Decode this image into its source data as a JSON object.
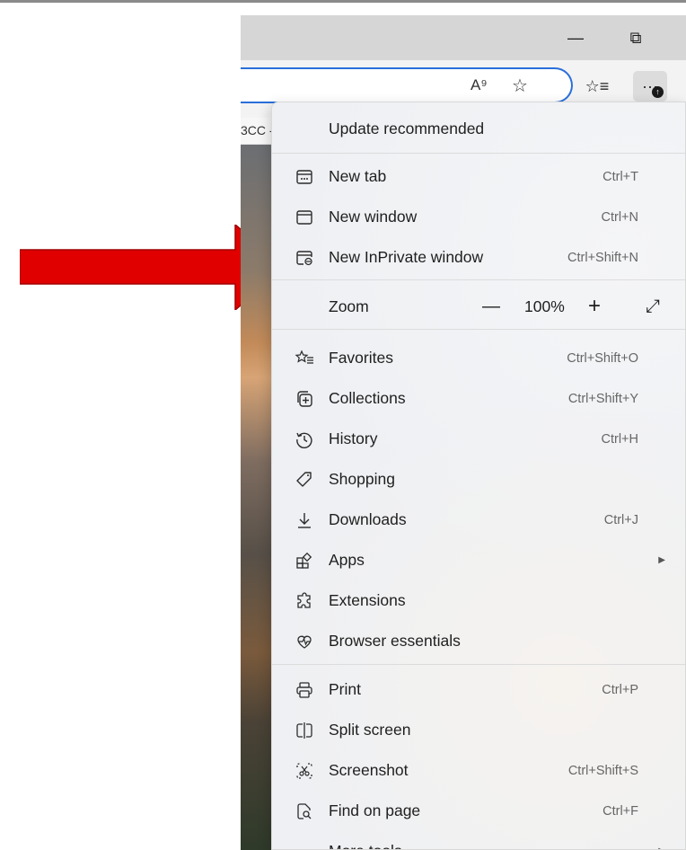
{
  "window": {
    "minimize_glyph": "—",
    "restore_glyph": "⧉"
  },
  "toolbar": {
    "read_aloud_icon": "A⁹",
    "favorite_icon": "☆",
    "favorites_icon": "☆≡",
    "more_icon": "···",
    "update_badge": "↑"
  },
  "favorites_bar": {
    "fragment_left": "3CC -",
    "fragment_right": "("
  },
  "menu": {
    "header": "Update recommended",
    "items": [
      {
        "label": "New tab",
        "shortcut": "Ctrl+T",
        "icon": "new-tab-icon"
      },
      {
        "label": "New window",
        "shortcut": "Ctrl+N",
        "icon": "new-window-icon"
      },
      {
        "label": "New InPrivate window",
        "shortcut": "Ctrl+Shift+N",
        "icon": "inprivate-icon"
      }
    ],
    "zoom": {
      "label": "Zoom",
      "minus": "—",
      "value": "100%",
      "plus": "+",
      "fullscreen": "⤢"
    },
    "items2": [
      {
        "label": "Favorites",
        "shortcut": "Ctrl+Shift+O",
        "icon": "favorites-icon"
      },
      {
        "label": "Collections",
        "shortcut": "Ctrl+Shift+Y",
        "icon": "collections-icon"
      },
      {
        "label": "History",
        "shortcut": "Ctrl+H",
        "icon": "history-icon"
      },
      {
        "label": "Shopping",
        "shortcut": "",
        "icon": "shopping-icon"
      },
      {
        "label": "Downloads",
        "shortcut": "Ctrl+J",
        "icon": "downloads-icon"
      },
      {
        "label": "Apps",
        "shortcut": "",
        "icon": "apps-icon",
        "submenu": true
      },
      {
        "label": "Extensions",
        "shortcut": "",
        "icon": "extensions-icon"
      },
      {
        "label": "Browser essentials",
        "shortcut": "",
        "icon": "browser-essentials-icon"
      }
    ],
    "items3": [
      {
        "label": "Print",
        "shortcut": "Ctrl+P",
        "icon": "print-icon"
      },
      {
        "label": "Split screen",
        "shortcut": "",
        "icon": "split-screen-icon"
      },
      {
        "label": "Screenshot",
        "shortcut": "Ctrl+Shift+S",
        "icon": "screenshot-icon"
      },
      {
        "label": "Find on page",
        "shortcut": "Ctrl+F",
        "icon": "find-icon"
      },
      {
        "label": "More tools",
        "shortcut": "",
        "icon": "more-tools-icon",
        "submenu": true
      }
    ],
    "submenu_arrow": "▶"
  },
  "colors": {
    "annotation_arrow": "#e00000",
    "address_border": "#2a6fdb"
  }
}
